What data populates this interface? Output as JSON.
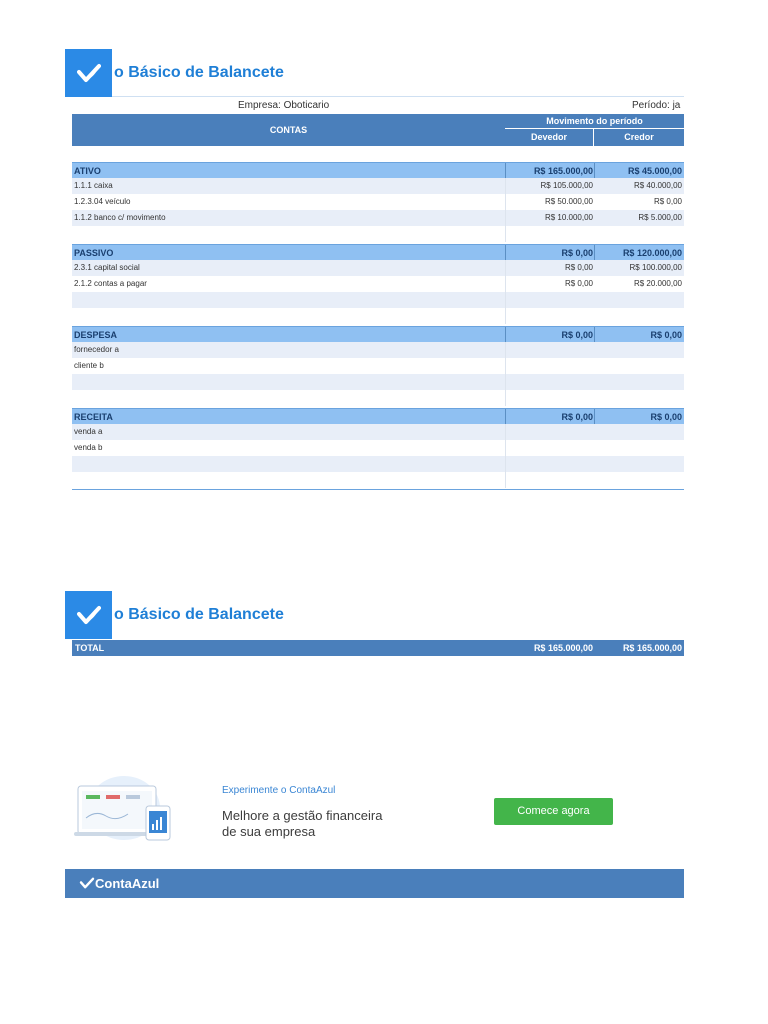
{
  "header": {
    "title": "o Básico de Balancete"
  },
  "sheet": {
    "company": "Empresa: Oboticario",
    "period": "Período: ja",
    "col_accounts": "CONTAS",
    "col_movement": "Movimento do período",
    "col_debit": "Devedor",
    "col_credit": "Credor",
    "sections": [
      {
        "name": "ATIVO",
        "debit": "R$ 165.000,00",
        "credit": "R$ 45.000,00",
        "rows": [
          {
            "account": "1.1.1 caixa",
            "debit": "R$ 105.000,00",
            "credit": "R$ 40.000,00"
          },
          {
            "account": "1.2.3.04 veículo",
            "debit": "R$ 50.000,00",
            "credit": "R$ 0,00"
          },
          {
            "account": "1.1.2 banco c/ movimento",
            "debit": "R$ 10.000,00",
            "credit": "R$ 5.000,00"
          }
        ]
      },
      {
        "name": "PASSIVO",
        "debit": "R$ 0,00",
        "credit": "R$ 120.000,00",
        "rows": [
          {
            "account": "2.3.1 capital social",
            "debit": "R$ 0,00",
            "credit": "R$ 100.000,00"
          },
          {
            "account": "2.1.2 contas a pagar",
            "debit": "R$ 0,00",
            "credit": "R$ 20.000,00"
          }
        ]
      },
      {
        "name": "DESPESA",
        "debit": "R$ 0,00",
        "credit": "R$ 0,00",
        "rows": [
          {
            "account": "fornecedor a",
            "debit": "",
            "credit": ""
          },
          {
            "account": "cliente b",
            "debit": "",
            "credit": ""
          }
        ]
      },
      {
        "name": "RECEITA",
        "debit": "R$ 0,00",
        "credit": "R$ 0,00",
        "rows": [
          {
            "account": "venda a",
            "debit": "",
            "credit": ""
          },
          {
            "account": "venda b",
            "debit": "",
            "credit": ""
          }
        ]
      }
    ]
  },
  "total": {
    "label": "TOTAL",
    "debit": "R$ 165.000,00",
    "credit": "R$ 165.000,00"
  },
  "promo": {
    "kicker": "Experimente o ContaAzul",
    "headline_line1": "Melhore a gestão financeira",
    "headline_line2": "de sua empresa",
    "cta": "Comece agora"
  },
  "footer": {
    "brand": "ContaAzul"
  },
  "colors": {
    "accent": "#2b8ae6",
    "header_blue": "#4a7fbb",
    "section_blue": "#8fc0f2",
    "cta_green": "#43b54a"
  }
}
